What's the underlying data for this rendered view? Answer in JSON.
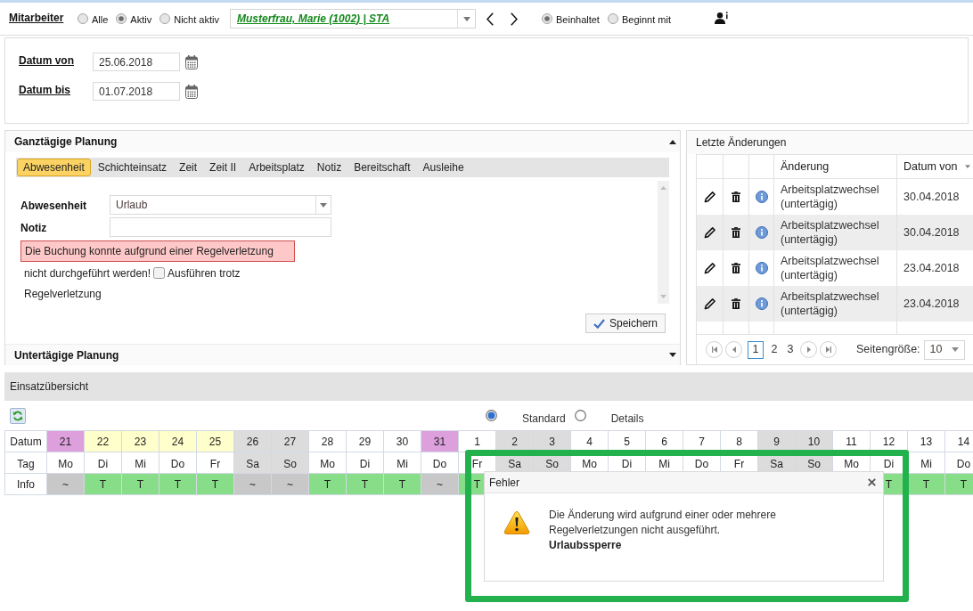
{
  "employee_filter": {
    "label": "Mitarbeiter",
    "status_options": [
      {
        "label": "Alle",
        "selected": false
      },
      {
        "label": "Aktiv",
        "selected": true
      },
      {
        "label": "Nicht aktiv",
        "selected": false
      }
    ],
    "employee": "Musterfrau, Marie (1002) | STA",
    "match_options": [
      {
        "label": "Beinhaltet",
        "selected": true
      },
      {
        "label": "Beginnt mit",
        "selected": false
      }
    ]
  },
  "date_range": [
    {
      "label": "Datum von",
      "value": "25.06.2018"
    },
    {
      "label": "Datum bis",
      "value": "01.07.2018"
    }
  ],
  "full_day_planning": {
    "title": "Ganztägige Planung",
    "expanded": true,
    "tabs": [
      {
        "label": "Abwesenheit",
        "selected": true
      },
      {
        "label": "Schichteinsatz",
        "selected": false
      },
      {
        "label": "Zeit",
        "selected": false
      },
      {
        "label": "Zeit II",
        "selected": false
      },
      {
        "label": "Arbeitsplatz",
        "selected": false
      },
      {
        "label": "Notiz",
        "selected": false
      },
      {
        "label": "Bereitschaft",
        "selected": false
      },
      {
        "label": "Ausleihe",
        "selected": false
      }
    ],
    "absence": {
      "label": "Abwesenheit",
      "value": "Urlaub"
    },
    "note": {
      "label": "Notiz"
    },
    "error": {
      "text": "Die Buchung konnte aufgrund einer Regelverletzung",
      "continuation": "nicht durchgeführt werden!"
    },
    "override": {
      "label": "Ausführen trotz",
      "label_continuation": "Regelverletzung",
      "checked": false
    },
    "save_button": "Speichern"
  },
  "recent_changes": {
    "title": "Letzte Änderungen",
    "columns": [
      "Änderung",
      "Datum von"
    ],
    "rows": [
      {
        "change": "Arbeitsplatzwechsel (untertägig)",
        "date_from": "30.04.2018"
      },
      {
        "change": "Arbeitsplatzwechsel (untertägig)",
        "date_from": "30.04.2018"
      },
      {
        "change": "Arbeitsplatzwechsel (untertägig)",
        "date_from": "23.04.2018"
      },
      {
        "change": "Arbeitsplatzwechsel (untertägig)",
        "date_from": "23.04.2018"
      }
    ],
    "pager": {
      "pages": [
        {
          "label": "1",
          "selected": true
        },
        {
          "label": "2",
          "selected": false
        },
        {
          "label": "3",
          "selected": false
        }
      ],
      "page_size_label": "Seitengröße:",
      "page_size": "10"
    }
  },
  "intraday_planning": {
    "title": "Untertägige Planung",
    "expanded": false
  },
  "assignment_overview": {
    "title": "Einsatzübersicht",
    "views": [
      {
        "label": "Standard",
        "selected": true
      },
      {
        "label": "Details",
        "selected": false
      }
    ],
    "row_labels": [
      "Datum",
      "Tag",
      "Info"
    ],
    "days": [
      {
        "date": "21",
        "weekday": "Mo",
        "color": "#dda0dd",
        "weekend": false,
        "info": {
          "text": "~",
          "color": "#c8c8c8"
        }
      },
      {
        "date": "22",
        "weekday": "Di",
        "color": "#ffffcc",
        "weekend": false,
        "info": {
          "text": "T",
          "color": "#88dd88"
        }
      },
      {
        "date": "23",
        "weekday": "Mi",
        "color": "#ffffcc",
        "weekend": false,
        "info": {
          "text": "T",
          "color": "#88dd88"
        }
      },
      {
        "date": "24",
        "weekday": "Do",
        "color": "#ffffcc",
        "weekend": false,
        "info": {
          "text": "T",
          "color": "#88dd88"
        }
      },
      {
        "date": "25",
        "weekday": "Fr",
        "color": "#ffffcc",
        "weekend": false,
        "info": {
          "text": "T",
          "color": "#88dd88"
        }
      },
      {
        "date": "26",
        "weekday": "Sa",
        "color": "#dcdcdc",
        "weekend": true,
        "info": {
          "text": "~",
          "color": "#c8c8c8"
        }
      },
      {
        "date": "27",
        "weekday": "So",
        "color": "#dcdcdc",
        "weekend": true,
        "info": {
          "text": "~",
          "color": "#c8c8c8"
        }
      },
      {
        "date": "28",
        "weekday": "Mo",
        "color": "#ffffff",
        "weekend": false,
        "info": {
          "text": "T",
          "color": "#88dd88"
        }
      },
      {
        "date": "29",
        "weekday": "Di",
        "color": "#ffffff",
        "weekend": false,
        "info": {
          "text": "T",
          "color": "#88dd88"
        }
      },
      {
        "date": "30",
        "weekday": "Mi",
        "color": "#ffffff",
        "weekend": false,
        "info": {
          "text": "T",
          "color": "#88dd88"
        }
      },
      {
        "date": "31",
        "weekday": "Do",
        "color": "#dda0dd",
        "weekend": false,
        "info": {
          "text": "~",
          "color": "#c8c8c8"
        }
      },
      {
        "date": "1",
        "weekday": "Fr",
        "color": "#ffffff",
        "weekend": false,
        "info": {
          "text": "T",
          "color": "#88dd88"
        }
      },
      {
        "date": "2",
        "weekday": "Sa",
        "color": "#dcdcdc",
        "weekend": true
      },
      {
        "date": "3",
        "weekday": "So",
        "color": "#dcdcdc",
        "weekend": true
      },
      {
        "date": "4",
        "weekday": "Mo",
        "color": "#ffffff",
        "weekend": false
      },
      {
        "date": "5",
        "weekday": "Di",
        "color": "#ffffff",
        "weekend": false
      },
      {
        "date": "6",
        "weekday": "Mi",
        "color": "#ffffff",
        "weekend": false
      },
      {
        "date": "7",
        "weekday": "Do",
        "color": "#ffffff",
        "weekend": false
      },
      {
        "date": "8",
        "weekday": "Fr",
        "color": "#ffffff",
        "weekend": false
      },
      {
        "date": "9",
        "weekday": "Sa",
        "color": "#dcdcdc",
        "weekend": true
      },
      {
        "date": "10",
        "weekday": "So",
        "color": "#dcdcdc",
        "weekend": true
      },
      {
        "date": "11",
        "weekday": "Mo",
        "color": "#ffffff",
        "weekend": false
      },
      {
        "date": "12",
        "weekday": "Di",
        "color": "#ffffff",
        "weekend": false,
        "info": {
          "text": "T",
          "color": "#88dd88"
        }
      },
      {
        "date": "13",
        "weekday": "Mi",
        "color": "#ffffff",
        "weekend": false,
        "info": {
          "text": "T",
          "color": "#88dd88"
        }
      },
      {
        "date": "14",
        "weekday": "Do",
        "color": "#ffffff",
        "weekend": false,
        "info": {
          "text": "T",
          "color": "#88dd88"
        }
      }
    ]
  },
  "error_dialog": {
    "title": "Fehler",
    "message": "Die Änderung wird aufgrund einer oder mehrere Regelverletzungen nicht ausgeführt.",
    "detail": "Urlaubssperre"
  }
}
